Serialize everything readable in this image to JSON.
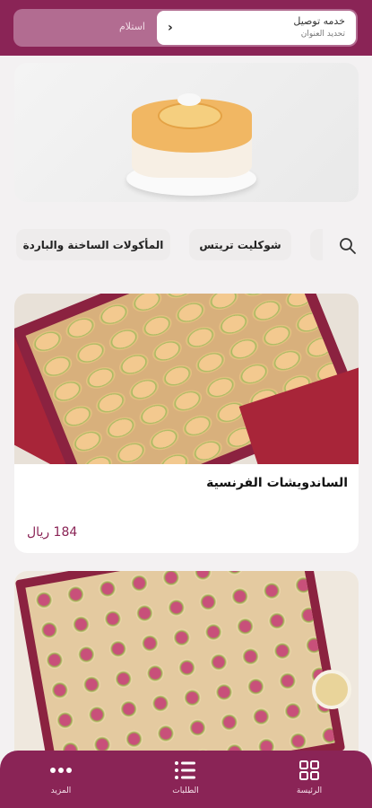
{
  "header": {
    "delivery_title": "خدمه توصيل",
    "delivery_subtitle": "تحديد العنوان",
    "pickup_label": "استلام"
  },
  "categories": [
    {
      "label": "شوكليت تريتس"
    },
    {
      "label": "المأكولات الساخنة والباردة"
    }
  ],
  "products": [
    {
      "title": "الساندويشات الفرنسية",
      "price": "184 ريال"
    }
  ],
  "bottom_nav": {
    "home": "الرئيسة",
    "orders": "الطلبات",
    "more": "المزيد"
  },
  "colors": {
    "brand": "#8a2456",
    "accent_light": "#b26c91"
  }
}
